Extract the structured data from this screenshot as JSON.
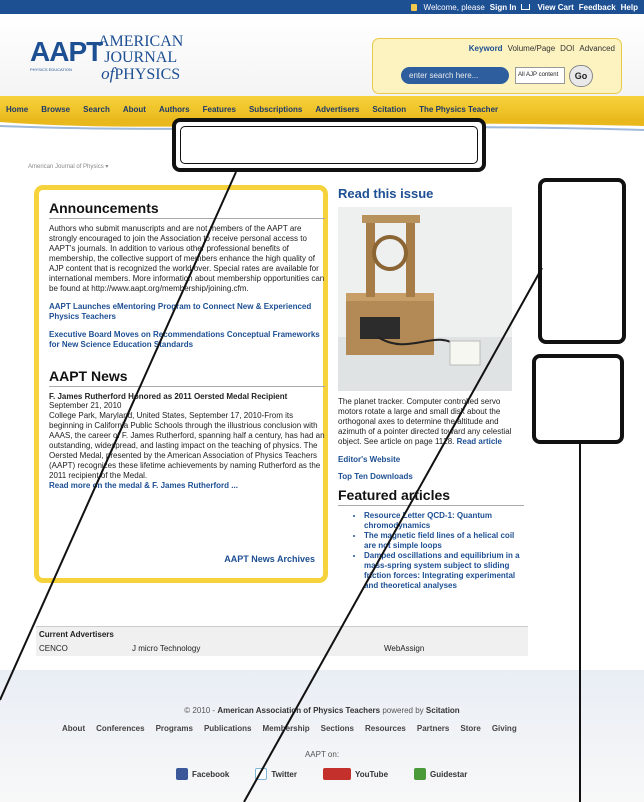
{
  "topbar": {
    "welcome": "Welcome, please",
    "sign_in": "Sign In",
    "view_cart": "View Cart",
    "feedback": "Feedback",
    "help": "Help"
  },
  "logo": {
    "acronym": "AAPT",
    "tagline": "PHYSICS EDUCATION"
  },
  "journal": {
    "line1": "AMERICAN",
    "line2": "JOURNAL",
    "line3_of": "of",
    "line3": "PHYSICS"
  },
  "search": {
    "options": [
      "Keyword",
      "Volume/Page",
      "DOI",
      "Advanced"
    ],
    "placeholder": "enter search here...",
    "scope": "All AJP content",
    "go": "Go"
  },
  "nav": {
    "items": [
      "Home",
      "Browse",
      "Search",
      "About",
      "Authors",
      "Features",
      "Subscriptions",
      "Advertisers",
      "Scitation",
      "The Physics Teacher"
    ]
  },
  "breadcrumb": "American Journal of Physics ▾",
  "announcements": {
    "title": "Announcements",
    "body": "Authors who submit manuscripts and are not members of the AAPT are strongly encouraged to join the Association to receive personal access to AAPT's journals. In addition to various other professional benefits of membership, the collective support of members enhance the high quality of AJP content that is recognized the world over. Special rates are available for international members. More information about membership opportunities can be found at http://www.aapt.org/membership/joining.cfm.",
    "link1": "AAPT Launches eMentoring Program to Connect New & Experienced Physics Teachers",
    "link2": "Executive Board Moves on Recommendations Conceptual Frameworks for New Science Education Standards"
  },
  "news": {
    "title": "AAPT News",
    "headline": "F. James Rutherford Honored as 2011 Oersted Medal Recipient",
    "date": "September 21, 2010",
    "body": "College Park, Maryland, United States, September 17, 2010-From its beginning in California Public Schools through the illustrious conclusion with AAAS, the career of F. James Rutherford, spanning half a century, has had an outstanding, widespread, and lasting impact on the teaching of physics. The Oersted Medal, presented by the American Association of Physics Teachers (AAPT) recognizes these lifetime achievements by naming Rutherford as the 2011 recipient of the Medal.",
    "more": "Read more on the medal & F. James Rutherford ...",
    "archives": "AAPT News Archives"
  },
  "issue": {
    "title": "Read this issue",
    "caption": "The planet tracker. Computer controlled servo motors rotate a large and small disk about the orthogonal axes to determine the altitude and azimuth of a pointer directed toward any celestial object. See article on page 1128.",
    "read_article": "Read article",
    "editors_website": "Editor's Website",
    "top_downloads": "Top Ten Downloads"
  },
  "featured": {
    "title": "Featured articles",
    "items": [
      "Resource Letter QCD-1: Quantum chromodynamics",
      "The magnetic field lines of a helical coil are not simple loops",
      "Damped oscillations and equilibrium in a mass-spring system subject to sliding friction forces: Integrating experimental and theoretical analyses"
    ]
  },
  "advertisers": {
    "title": "Current Advertisers",
    "items": [
      "CENCO",
      "J micro Technology",
      "WebAssign"
    ]
  },
  "footer": {
    "copyright_prefix": "© 2010 -",
    "org": "American Association of Physics Teachers",
    "powered": "powered by",
    "scitation": "Scitation",
    "links": [
      "About",
      "Conferences",
      "Programs",
      "Publications",
      "Membership",
      "Sections",
      "Resources",
      "Partners",
      "Store",
      "Giving"
    ],
    "aapt_on": "AAPT on:",
    "social": [
      "Facebook",
      "Twitter",
      "YouTube",
      "Guidestar"
    ]
  },
  "colors": {
    "brand_blue": "#1d4f93",
    "nav_yellow": "#f6d33c",
    "panel_yellow": "#fdf3c0"
  }
}
